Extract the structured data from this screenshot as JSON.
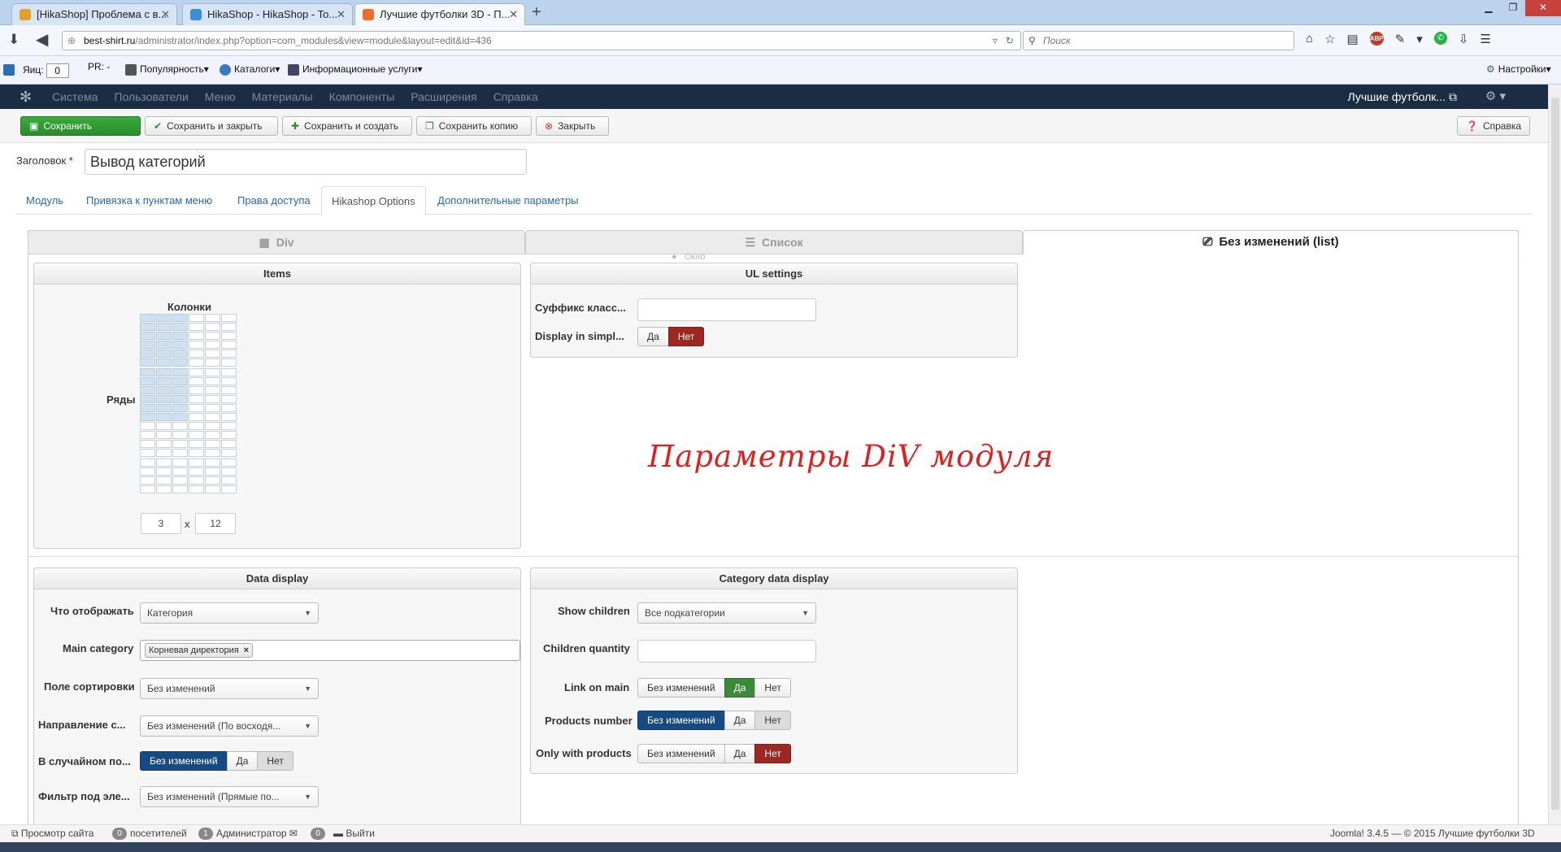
{
  "browser": {
    "tabs": [
      {
        "title": "[HikaShop] Проблема с в...",
        "favicon_color": "#e4a12a"
      },
      {
        "title": "HikaShop - HikaShop - To...",
        "favicon_color": "#3a8ed8"
      },
      {
        "title": "Лучшие футболки 3D - П...",
        "favicon_color": "#f36b2b"
      }
    ],
    "url_host": "best-shirt.ru",
    "url_path": "/administrator/index.php?option=com_modules&view=module&layout=edit&id=436",
    "search_placeholder": "Поиск",
    "bookmarks": {
      "yandex_label": "Яиц:",
      "yandex_value": "0",
      "pr_label": "PR: -",
      "popularity": "Популярность▾",
      "catalogs": "Каталоги▾",
      "info": "Информационные услуги▾",
      "settings": "Настройки▾"
    }
  },
  "joomla": {
    "menu": [
      "Система",
      "Пользователи",
      "Меню",
      "Материалы",
      "Компоненты",
      "Расширения",
      "Справка"
    ],
    "site_name": "Лучшие футболк...",
    "toolbar": {
      "save": "Сохранить",
      "save_close": "Сохранить и закрыть",
      "save_new": "Сохранить и создать",
      "save_copy": "Сохранить копию",
      "close": "Закрыть",
      "help": "Справка"
    },
    "title_label": "Заголовок *",
    "title_value": "Вывод категорий",
    "tabs": [
      "Модуль",
      "Привязка к пунктам меню",
      "Права доступа",
      "Hikashop Options",
      "Дополнительные параметры"
    ]
  },
  "layout_tabs": {
    "div": "Div",
    "list": "Список",
    "inherit": "Без изменений (list)",
    "ghost": "Окно"
  },
  "items_panel": {
    "title": "Items",
    "columns_label": "Колонки",
    "rows_label": "Ряды",
    "cols_value": "3",
    "rows_value": "12",
    "x": "x",
    "selected_cols": 3,
    "selected_rows": 12
  },
  "ul_panel": {
    "title": "UL settings",
    "class_suffix_label": "Суффикс класс...",
    "simple_label": "Display in simpl...",
    "yes": "Да",
    "no": "Нет"
  },
  "annotation": "Параметры DiV модуля",
  "data_display": {
    "title": "Data display",
    "what_label": "Что отображать",
    "what_value": "Категория",
    "main_cat_label": "Main category",
    "main_cat_tag": "Корневая директория",
    "sort_label": "Поле сортировки",
    "sort_value": "Без изменений",
    "dir_label": "Направление с...",
    "dir_value": "Без изменений (По восходя...",
    "random_label": "В случайном по...",
    "random_opts": [
      "Без изменений",
      "Да",
      "Нет"
    ],
    "filter_label": "Фильтр под эле...",
    "filter_value": "Без изменений (Прямые по..."
  },
  "category_display": {
    "title": "Category data display",
    "show_children_label": "Show children",
    "show_children_value": "Все подкатегории",
    "children_qty_label": "Children quantity",
    "link_main_label": "Link on main",
    "link_main_opts": [
      "Без изменений",
      "Да",
      "Нет"
    ],
    "products_num_label": "Products number",
    "products_num_opts": [
      "Без изменений",
      "Да",
      "Нет"
    ],
    "only_products_label": "Only with products",
    "only_products_opts": [
      "Без изменений",
      "Да",
      "Нет"
    ]
  },
  "statusbar": {
    "view_site": "Просмотр сайта",
    "visitors_count": "0",
    "visitors": "посетителей",
    "admins_count": "1",
    "admins": "Администратор",
    "messages_count": "0",
    "logout": "Выйти",
    "footer": "Joomla! 3.4.5 — © 2015 Лучшие футболки 3D"
  }
}
